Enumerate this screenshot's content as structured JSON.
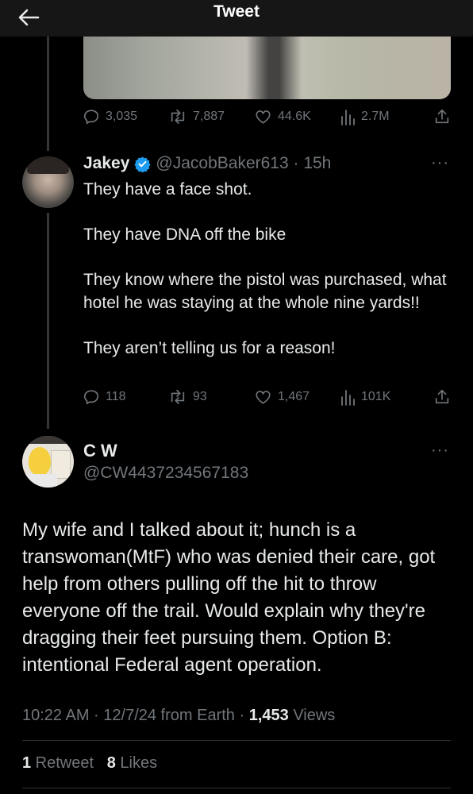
{
  "header": {
    "title": "Tweet",
    "back_icon": "arrow-left-icon"
  },
  "parent_actions": {
    "replies": "3,035",
    "retweets": "7,887",
    "likes": "44.6K",
    "views": "2.7M"
  },
  "reply_tweet": {
    "display_name": "Jakey",
    "verified": true,
    "handle_time": "@JacobBaker613 · 15h",
    "more": "···",
    "lines": [
      "They have a face shot.",
      "They have DNA off the bike",
      "They know where the pistol was purchased, what hotel he was staying at the whole nine yards!!",
      "They aren’t telling us for a reason!"
    ],
    "actions": {
      "replies": "118",
      "retweets": "93",
      "likes": "1,467",
      "views": "101K"
    }
  },
  "main_tweet": {
    "display_name": "C W",
    "handle": "@CW4437234567183",
    "more": "···",
    "text": "My wife and I talked about it; hunch is a transwoman(MtF) who was denied their care, got help from others pulling off the hit to throw everyone off the trail. Would explain why they're dragging their feet pursuing them. Option B: intentional Federal agent operation.",
    "meta_prefix": "10:22 AM · 12/7/24 from Earth · ",
    "views_count": "1,453",
    "views_label": " Views",
    "retweet_count": "1",
    "retweet_label": " Retweet",
    "like_count": "8",
    "like_label": " Likes"
  },
  "colors": {
    "background": "#000000",
    "text": "#e7e9ea",
    "muted": "#71767b",
    "verified": "#1d9bf0",
    "divider": "#2f3336"
  }
}
